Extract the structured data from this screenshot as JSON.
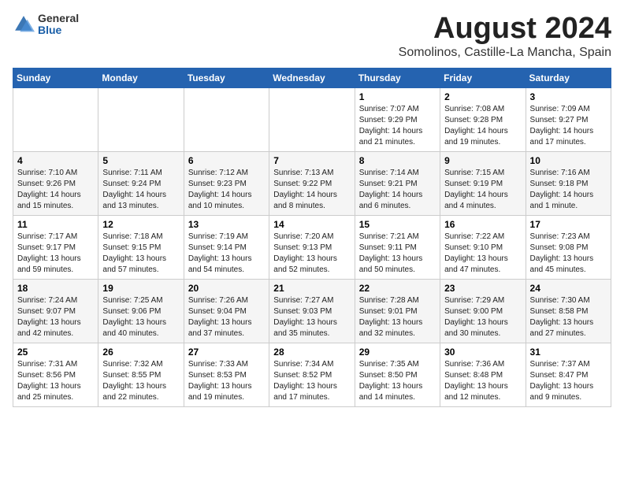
{
  "header": {
    "logo_general": "General",
    "logo_blue": "Blue",
    "month_year": "August 2024",
    "location": "Somolinos, Castille-La Mancha, Spain"
  },
  "weekdays": [
    "Sunday",
    "Monday",
    "Tuesday",
    "Wednesday",
    "Thursday",
    "Friday",
    "Saturday"
  ],
  "weeks": [
    [
      {
        "day": "",
        "info": ""
      },
      {
        "day": "",
        "info": ""
      },
      {
        "day": "",
        "info": ""
      },
      {
        "day": "",
        "info": ""
      },
      {
        "day": "1",
        "info": "Sunrise: 7:07 AM\nSunset: 9:29 PM\nDaylight: 14 hours\nand 21 minutes."
      },
      {
        "day": "2",
        "info": "Sunrise: 7:08 AM\nSunset: 9:28 PM\nDaylight: 14 hours\nand 19 minutes."
      },
      {
        "day": "3",
        "info": "Sunrise: 7:09 AM\nSunset: 9:27 PM\nDaylight: 14 hours\nand 17 minutes."
      }
    ],
    [
      {
        "day": "4",
        "info": "Sunrise: 7:10 AM\nSunset: 9:26 PM\nDaylight: 14 hours\nand 15 minutes."
      },
      {
        "day": "5",
        "info": "Sunrise: 7:11 AM\nSunset: 9:24 PM\nDaylight: 14 hours\nand 13 minutes."
      },
      {
        "day": "6",
        "info": "Sunrise: 7:12 AM\nSunset: 9:23 PM\nDaylight: 14 hours\nand 10 minutes."
      },
      {
        "day": "7",
        "info": "Sunrise: 7:13 AM\nSunset: 9:22 PM\nDaylight: 14 hours\nand 8 minutes."
      },
      {
        "day": "8",
        "info": "Sunrise: 7:14 AM\nSunset: 9:21 PM\nDaylight: 14 hours\nand 6 minutes."
      },
      {
        "day": "9",
        "info": "Sunrise: 7:15 AM\nSunset: 9:19 PM\nDaylight: 14 hours\nand 4 minutes."
      },
      {
        "day": "10",
        "info": "Sunrise: 7:16 AM\nSunset: 9:18 PM\nDaylight: 14 hours\nand 1 minute."
      }
    ],
    [
      {
        "day": "11",
        "info": "Sunrise: 7:17 AM\nSunset: 9:17 PM\nDaylight: 13 hours\nand 59 minutes."
      },
      {
        "day": "12",
        "info": "Sunrise: 7:18 AM\nSunset: 9:15 PM\nDaylight: 13 hours\nand 57 minutes."
      },
      {
        "day": "13",
        "info": "Sunrise: 7:19 AM\nSunset: 9:14 PM\nDaylight: 13 hours\nand 54 minutes."
      },
      {
        "day": "14",
        "info": "Sunrise: 7:20 AM\nSunset: 9:13 PM\nDaylight: 13 hours\nand 52 minutes."
      },
      {
        "day": "15",
        "info": "Sunrise: 7:21 AM\nSunset: 9:11 PM\nDaylight: 13 hours\nand 50 minutes."
      },
      {
        "day": "16",
        "info": "Sunrise: 7:22 AM\nSunset: 9:10 PM\nDaylight: 13 hours\nand 47 minutes."
      },
      {
        "day": "17",
        "info": "Sunrise: 7:23 AM\nSunset: 9:08 PM\nDaylight: 13 hours\nand 45 minutes."
      }
    ],
    [
      {
        "day": "18",
        "info": "Sunrise: 7:24 AM\nSunset: 9:07 PM\nDaylight: 13 hours\nand 42 minutes."
      },
      {
        "day": "19",
        "info": "Sunrise: 7:25 AM\nSunset: 9:06 PM\nDaylight: 13 hours\nand 40 minutes."
      },
      {
        "day": "20",
        "info": "Sunrise: 7:26 AM\nSunset: 9:04 PM\nDaylight: 13 hours\nand 37 minutes."
      },
      {
        "day": "21",
        "info": "Sunrise: 7:27 AM\nSunset: 9:03 PM\nDaylight: 13 hours\nand 35 minutes."
      },
      {
        "day": "22",
        "info": "Sunrise: 7:28 AM\nSunset: 9:01 PM\nDaylight: 13 hours\nand 32 minutes."
      },
      {
        "day": "23",
        "info": "Sunrise: 7:29 AM\nSunset: 9:00 PM\nDaylight: 13 hours\nand 30 minutes."
      },
      {
        "day": "24",
        "info": "Sunrise: 7:30 AM\nSunset: 8:58 PM\nDaylight: 13 hours\nand 27 minutes."
      }
    ],
    [
      {
        "day": "25",
        "info": "Sunrise: 7:31 AM\nSunset: 8:56 PM\nDaylight: 13 hours\nand 25 minutes."
      },
      {
        "day": "26",
        "info": "Sunrise: 7:32 AM\nSunset: 8:55 PM\nDaylight: 13 hours\nand 22 minutes."
      },
      {
        "day": "27",
        "info": "Sunrise: 7:33 AM\nSunset: 8:53 PM\nDaylight: 13 hours\nand 19 minutes."
      },
      {
        "day": "28",
        "info": "Sunrise: 7:34 AM\nSunset: 8:52 PM\nDaylight: 13 hours\nand 17 minutes."
      },
      {
        "day": "29",
        "info": "Sunrise: 7:35 AM\nSunset: 8:50 PM\nDaylight: 13 hours\nand 14 minutes."
      },
      {
        "day": "30",
        "info": "Sunrise: 7:36 AM\nSunset: 8:48 PM\nDaylight: 13 hours\nand 12 minutes."
      },
      {
        "day": "31",
        "info": "Sunrise: 7:37 AM\nSunset: 8:47 PM\nDaylight: 13 hours\nand 9 minutes."
      }
    ]
  ]
}
